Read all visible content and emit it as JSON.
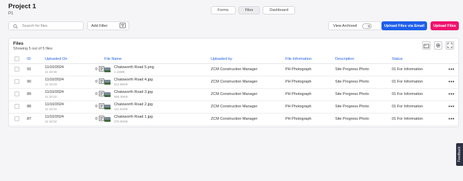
{
  "project": {
    "title": "Project 1",
    "subtitle": "P1"
  },
  "tabs": [
    {
      "label": "Forms",
      "active": false
    },
    {
      "label": "Files",
      "active": true
    },
    {
      "label": "Dashboard",
      "active": false
    }
  ],
  "toolbar": {
    "search_placeholder": "Search for files",
    "add_filter_label": "Add Filter",
    "view_archived_label": "View Archived",
    "upload_email_label": "Upload Files via Email",
    "upload_label": "Upload Files"
  },
  "files_panel": {
    "title": "Files",
    "count_text": "Showing 5 out of 5 files",
    "columns": [
      "ID",
      "Uploaded On",
      "File Name",
      "Uploaded by",
      "File Information",
      "Description",
      "Status"
    ],
    "rows": [
      {
        "id": "91",
        "date": "11/10/2024",
        "time": "11:18:35",
        "count": "0",
        "file_name": "Chatsworth Road 5.png",
        "file_size": "1.15MB",
        "uploaded_by": "ZCM Construction Manager",
        "file_info": "PH Photograph",
        "description": "Site Progress Photo",
        "status": "01 For Information"
      },
      {
        "id": "90",
        "date": "11/10/2024",
        "time": "11:18:33",
        "count": "0",
        "file_name": "Chatsworth Road 4.jpg",
        "file_size": "312.85KB",
        "uploaded_by": "ZCM Construction Manager",
        "file_info": "PH Photograph",
        "description": "Site Progress Photo",
        "status": "01 For Information"
      },
      {
        "id": "89",
        "date": "11/10/2024",
        "time": "11:18:32",
        "count": "0",
        "file_name": "Chatsworth Road 3.jpg",
        "file_size": "566.49KB",
        "uploaded_by": "ZCM Construction Manager",
        "file_info": "PH Photograph",
        "description": "Site Progress Photo",
        "status": "01 For Information"
      },
      {
        "id": "88",
        "date": "11/10/2024",
        "time": "11:18:32",
        "count": "0",
        "file_name": "Chatsworth Road 2.jpg",
        "file_size": "121.52KB",
        "uploaded_by": "ZCM Construction Manager",
        "file_info": "PH Photograph",
        "description": "Site Progress Photo",
        "status": "01 For Information"
      },
      {
        "id": "87",
        "date": "11/10/2024",
        "time": "11:18:32",
        "count": "0",
        "file_name": "Chatsworth Road 1.jpg",
        "file_size": "375.06KB",
        "uploaded_by": "ZCM Construction Manager",
        "file_info": "PH Photograph",
        "description": "Site Progress Photo",
        "status": "01 For Information"
      }
    ]
  },
  "feedback_label": "Feedback",
  "colors": {
    "accent_blue": "#1e5eea",
    "accent_pink": "#f0126e",
    "feedback_bg": "#2d3142"
  },
  "icons": [
    "search-icon",
    "filter-icon",
    "comment-icon",
    "image-thumbnail-icon",
    "more-options-icon",
    "new-folder-icon",
    "settings-icon",
    "expand-icon"
  ]
}
